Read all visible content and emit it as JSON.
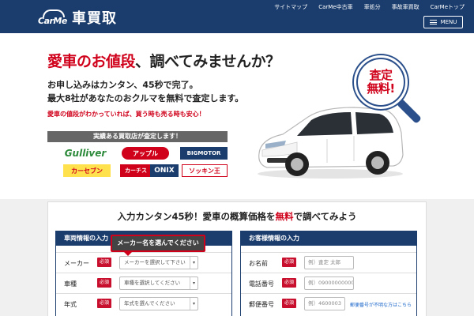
{
  "header": {
    "logo_mark": "CarMe",
    "logo_text": "車買取",
    "nav": [
      "サイトマップ",
      "CarMe中古車",
      "車処分",
      "事故車買取",
      "CarMeトップ"
    ],
    "menu_label": "MENU"
  },
  "hero": {
    "headline_red": "愛車のお値段",
    "headline_rest": "、調べてみませんか？",
    "sub_line1": "お申し込みはカンタン、45秒で完了。",
    "sub_line2": "最大8社があなたのおクルマを無料で査定します。",
    "note": "愛車の値段がわかっていれば、買う時も売る時も安心！",
    "buyers_banner": "実績ある買取店が査定します！",
    "badge_line1": "査定",
    "badge_line2": "無料!"
  },
  "buyers": [
    {
      "name": "Gulliver",
      "color": "#2c8a3a",
      "bg": "#ffffff"
    },
    {
      "name": "アップル",
      "color": "#ffffff",
      "bg": "#d0021b"
    },
    {
      "name": "BIGMOTOR",
      "color": "#ffffff",
      "bg": "#1b3d6d"
    },
    {
      "name": "カーセブン",
      "color": "#d0021b",
      "bg": "#ffe14d"
    },
    {
      "name": "カーチス",
      "color": "#ffffff",
      "bg": "#d0021b"
    },
    {
      "name": "ONIX",
      "color": "#ffffff",
      "bg": "#1b3d6d"
    },
    {
      "name": "ソッキン王",
      "color": "#d0021b",
      "bg": "#ffffff"
    }
  ],
  "form": {
    "title_pre": "入力カンタン45秒！愛車の概算価格を",
    "title_red": "無料",
    "title_post": "で調べてみよう",
    "tooltip": "メーカー名を選んでください",
    "vehicle": {
      "heading": "車両情報の入力",
      "required_label": "必須",
      "rows": [
        {
          "label": "メーカー",
          "placeholder": "メーカーを選択して下さい"
        },
        {
          "label": "車種",
          "placeholder": "車種を選択してください"
        },
        {
          "label": "年式",
          "placeholder": "年式を選んでください"
        }
      ]
    },
    "customer": {
      "heading": "お客様情報の入力",
      "required_label": "必須",
      "rows": [
        {
          "label": "お名前",
          "placeholder": "例）査定 太郎"
        },
        {
          "label": "電話番号",
          "placeholder": "例）09000000000"
        },
        {
          "label": "郵便番号",
          "placeholder": "例）4600003"
        }
      ],
      "zip_link": "郵便番号が不明な方はこちら"
    }
  },
  "colors": {
    "navy": "#1b3d6d",
    "red": "#d0021b",
    "link": "#1a66c9"
  },
  "icons": [
    "carme-logo-icon",
    "menu-icon",
    "magnifier-icon",
    "car-image",
    "dropdown-arrow-icon"
  ]
}
